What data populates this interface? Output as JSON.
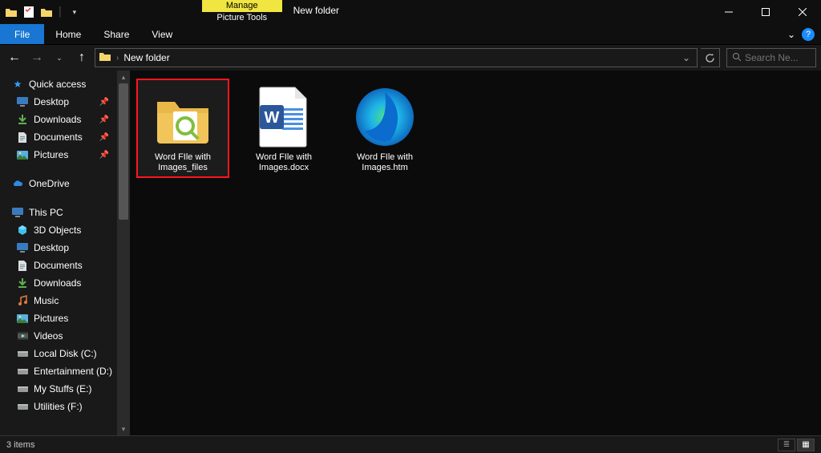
{
  "titlebar": {
    "manage_label": "Manage",
    "manage_sub": "Picture Tools",
    "window_title": "New folder"
  },
  "ribbon": {
    "file": "File",
    "home": "Home",
    "share": "Share",
    "view": "View"
  },
  "address": {
    "location": "New folder",
    "search_placeholder": "Search Ne..."
  },
  "sidebar": {
    "quick_access": "Quick access",
    "quick_items": [
      {
        "label": "Desktop",
        "icon": "desktop",
        "pinned": true
      },
      {
        "label": "Downloads",
        "icon": "download",
        "pinned": true
      },
      {
        "label": "Documents",
        "icon": "document",
        "pinned": true
      },
      {
        "label": "Pictures",
        "icon": "picture",
        "pinned": true
      }
    ],
    "onedrive": "OneDrive",
    "this_pc": "This PC",
    "pc_items": [
      {
        "label": "3D Objects",
        "icon": "cube"
      },
      {
        "label": "Desktop",
        "icon": "desktop"
      },
      {
        "label": "Documents",
        "icon": "document"
      },
      {
        "label": "Downloads",
        "icon": "download"
      },
      {
        "label": "Music",
        "icon": "music"
      },
      {
        "label": "Pictures",
        "icon": "picture"
      },
      {
        "label": "Videos",
        "icon": "video"
      },
      {
        "label": "Local Disk (C:)",
        "icon": "disk"
      },
      {
        "label": "Entertainment (D:)",
        "icon": "disk"
      },
      {
        "label": "My Stuffs (E:)",
        "icon": "disk"
      },
      {
        "label": "Utilities (F:)",
        "icon": "disk"
      }
    ]
  },
  "files": [
    {
      "label": "Word FIle with Images_files",
      "type": "folder",
      "selected": true
    },
    {
      "label": "Word FIle with Images.docx",
      "type": "docx",
      "selected": false
    },
    {
      "label": "Word FIle with Images.htm",
      "type": "htm",
      "selected": false
    }
  ],
  "status": {
    "count_label": "3 items"
  }
}
